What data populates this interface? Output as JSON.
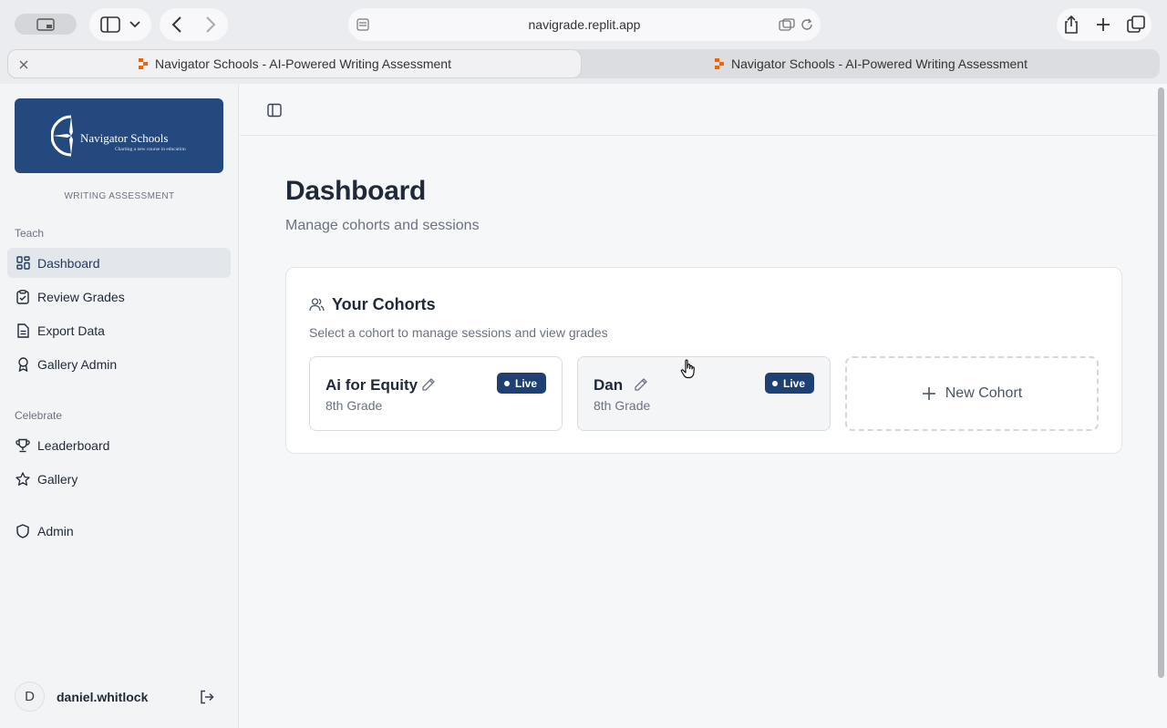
{
  "browser": {
    "url": "navigrade.replit.app",
    "tabs": [
      {
        "title": "Navigator Schools - AI-Powered Writing Assessment",
        "active": true
      },
      {
        "title": "Navigator Schools - AI-Powered Writing Assessment",
        "active": false
      }
    ]
  },
  "sidebar": {
    "logo": {
      "name": "Navigator Schools",
      "tagline": "Charting a new course in education"
    },
    "subtitle": "WRITING ASSESSMENT",
    "sections": [
      {
        "label": "Teach"
      },
      {
        "label": "Celebrate"
      }
    ],
    "items": [
      {
        "label": "Dashboard",
        "icon": "grid-icon"
      },
      {
        "label": "Review Grades",
        "icon": "clipboard-check-icon"
      },
      {
        "label": "Export Data",
        "icon": "file-text-icon"
      },
      {
        "label": "Gallery Admin",
        "icon": "award-icon"
      },
      {
        "label": "Leaderboard",
        "icon": "trophy-icon"
      },
      {
        "label": "Gallery",
        "icon": "star-icon"
      },
      {
        "label": "Admin",
        "icon": "shield-icon"
      }
    ],
    "user": {
      "initial": "D",
      "name": "daniel.whitlock"
    }
  },
  "main": {
    "title": "Dashboard",
    "subtitle": "Manage cohorts and sessions",
    "cohorts_card": {
      "title": "Your Cohorts",
      "description": "Select a cohort to manage sessions and view grades",
      "cohorts": [
        {
          "name": "Ai for Equity",
          "grade": "8th Grade",
          "status": "Live"
        },
        {
          "name": "Dan",
          "grade": "8th Grade",
          "status": "Live"
        }
      ],
      "new_label": "New Cohort"
    }
  },
  "colors": {
    "brand": "#23497f",
    "live_badge": "#1f4072"
  }
}
